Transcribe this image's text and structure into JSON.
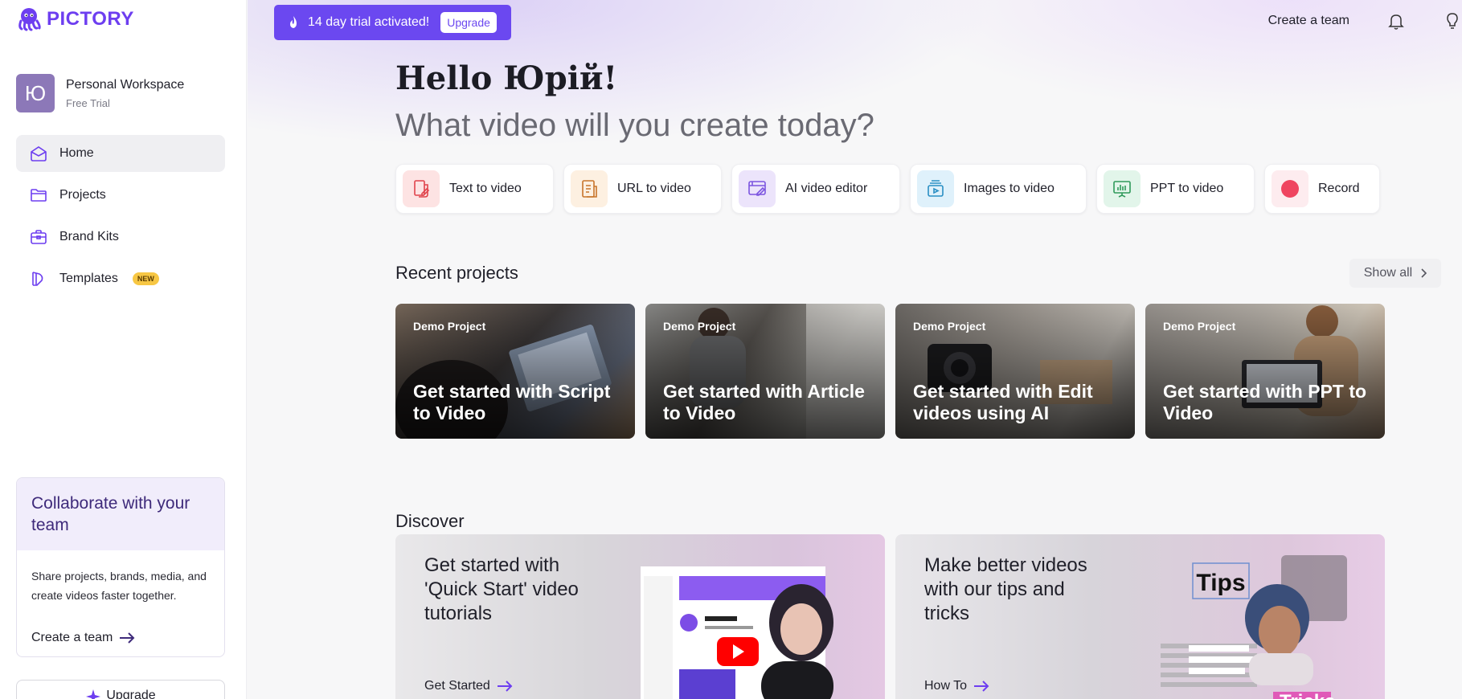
{
  "app": {
    "logo_text": "PICTORY",
    "brand_color": "#6d3ef0"
  },
  "workspace": {
    "avatar_letter": "Ю",
    "name": "Personal Workspace",
    "plan": "Free Trial"
  },
  "sidebar": {
    "items": [
      {
        "label": "Home",
        "icon": "home-icon",
        "active": true
      },
      {
        "label": "Projects",
        "icon": "folder-icon",
        "active": false
      },
      {
        "label": "Brand Kits",
        "icon": "briefcase-icon",
        "active": false
      },
      {
        "label": "Templates",
        "icon": "templates-icon",
        "active": false,
        "badge": "NEW"
      }
    ],
    "collab": {
      "title": "Collaborate with your team",
      "desc": "Share projects, brands, media, and create videos faster together.",
      "link": "Create a team"
    },
    "upgrade_label": "Upgrade"
  },
  "topbar": {
    "trial_text": "14 day trial activated!",
    "trial_upgrade": "Upgrade",
    "create_team": "Create a team",
    "icons": [
      "bell-icon",
      "lightbulb-icon"
    ]
  },
  "hero": {
    "hello": "Hello Юрій!",
    "subtitle": "What video will you create today?"
  },
  "actions": [
    {
      "label": "Text to video",
      "icon": "text-to-video-icon",
      "bg": "#fde3e3",
      "color": "#e0434b"
    },
    {
      "label": "URL to video",
      "icon": "url-to-video-icon",
      "bg": "#fdf0e1",
      "color": "#c8742a"
    },
    {
      "label": "AI video editor",
      "icon": "ai-editor-icon",
      "bg": "#ece4fb",
      "color": "#7c55e0"
    },
    {
      "label": "Images to video",
      "icon": "images-to-video-icon",
      "bg": "#dff1fb",
      "color": "#2a8fc4"
    },
    {
      "label": "PPT to video",
      "icon": "ppt-to-video-icon",
      "bg": "#e2f5ea",
      "color": "#2f9a5a"
    },
    {
      "label": "Record",
      "icon": "record-icon",
      "bg": "#fdecef",
      "color": "#ef4560"
    }
  ],
  "recent": {
    "title": "Recent projects",
    "show_all": "Show all",
    "projects": [
      {
        "tag": "Demo Project",
        "title": "Get started with Script to Video"
      },
      {
        "tag": "Demo Project",
        "title": "Get started with Article to Video"
      },
      {
        "tag": "Demo Project",
        "title": "Get started with Edit videos using AI"
      },
      {
        "tag": "Demo Project",
        "title": "Get started with PPT to Video"
      }
    ]
  },
  "discover": {
    "title": "Discover",
    "cards": [
      {
        "title": "Get started with 'Quick Start' video tutorials",
        "link": "Get Started"
      },
      {
        "title": "Make better videos with our tips and tricks",
        "link": "How To",
        "art_word_1": "Tips",
        "art_word_2": "Tricks"
      }
    ]
  }
}
